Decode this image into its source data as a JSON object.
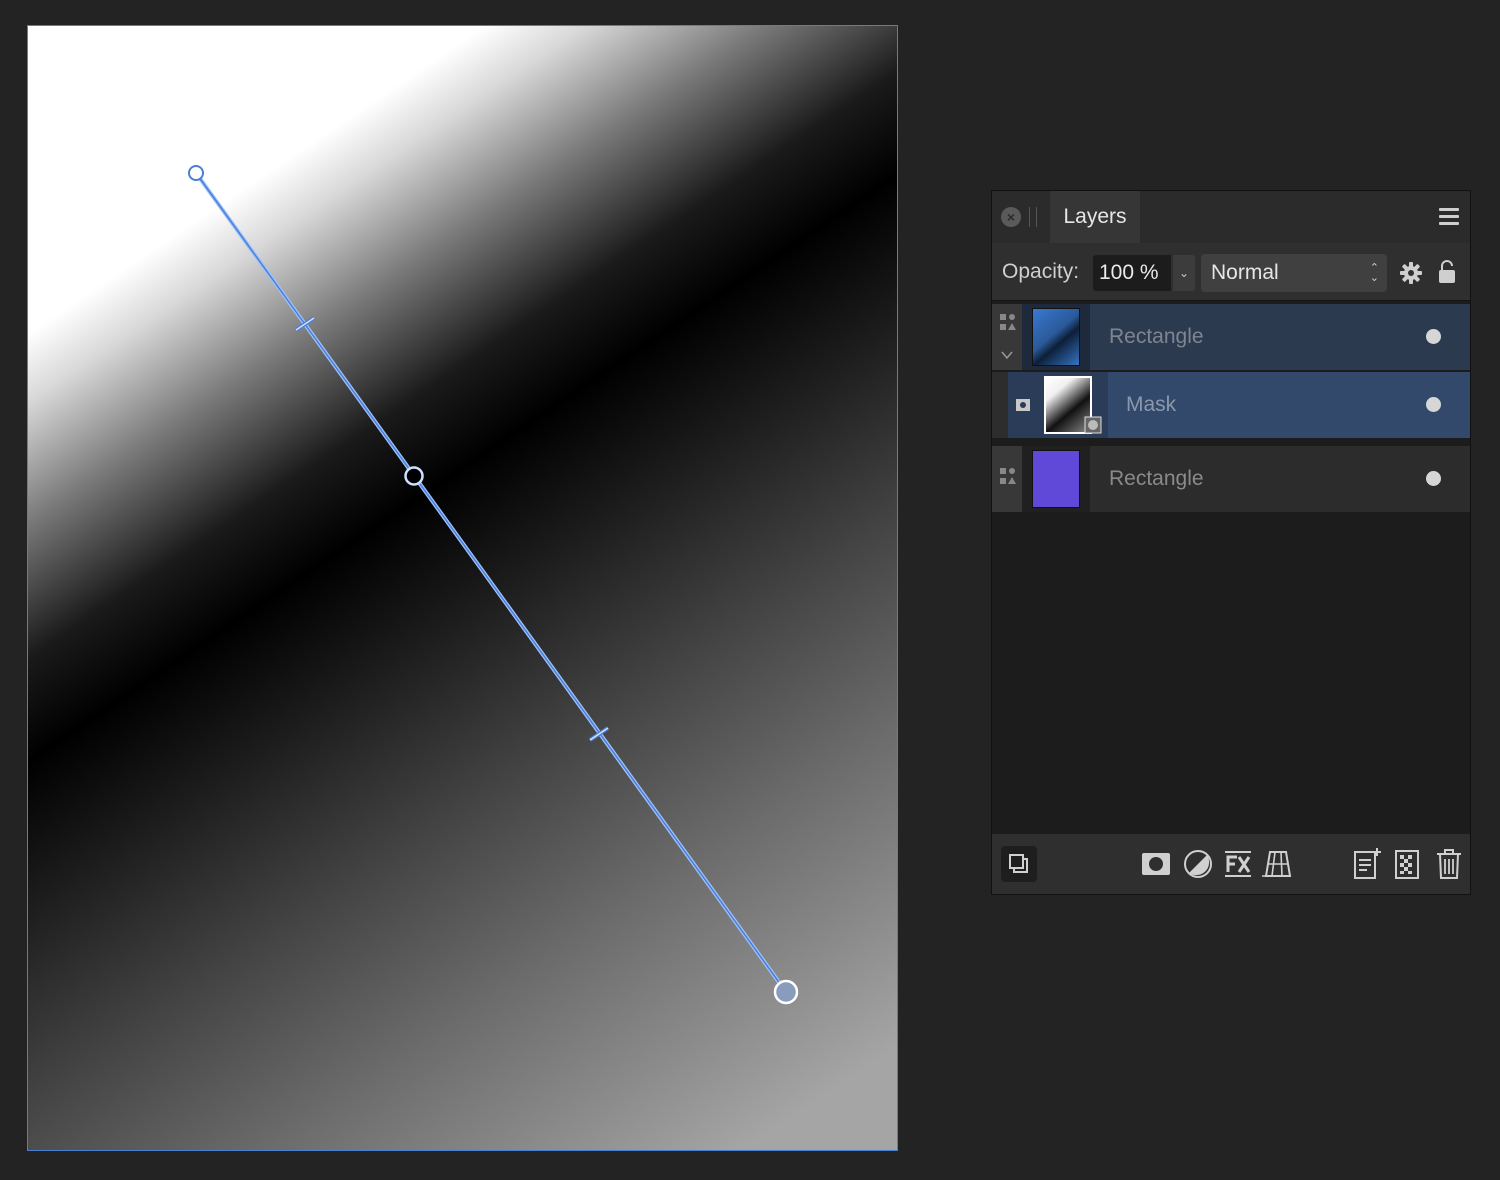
{
  "panel": {
    "tab_label": "Layers",
    "opacity_label": "Opacity:",
    "opacity_value": "100 %",
    "blend_mode": "Normal"
  },
  "layers": [
    {
      "name": "Rectangle",
      "thumb_color": "#3a78d0"
    },
    {
      "name": "Mask",
      "thumb_color": "#ffffff"
    },
    {
      "name": "Rectangle",
      "thumb_color": "#6048d8"
    }
  ],
  "colors": {
    "accent": "#4a7fd4",
    "selected_row": "#33496b",
    "panel_bg": "#1c1c1c"
  },
  "icons": {
    "header": [
      "close-icon",
      "grip-icon",
      "menu-icon"
    ],
    "opacity_bar": [
      "chevron-down-icon",
      "updown-arrows-icon",
      "gear-icon",
      "lock-icon"
    ],
    "toolbar": [
      "layer-options-icon",
      "mask-layer-icon",
      "adjustment-icon",
      "fx-icon",
      "live-filter-icon",
      "add-pixel-layer-icon",
      "add-group-icon",
      "delete-icon"
    ]
  }
}
